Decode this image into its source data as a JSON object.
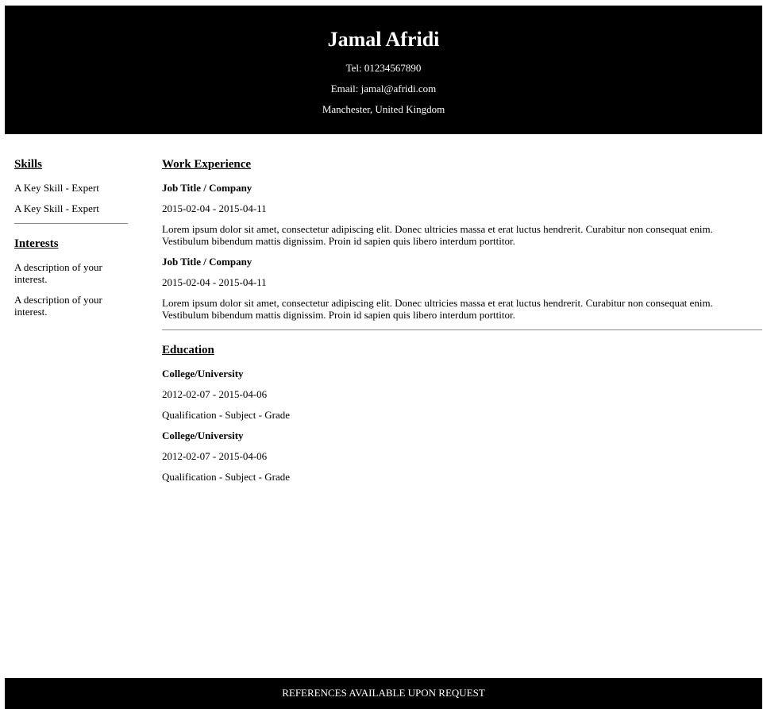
{
  "header": {
    "name": "Jamal Afridi",
    "tel": "Tel: 01234567890",
    "email": "Email: jamal@afridi.com",
    "location": "Manchester, United Kingdom"
  },
  "sidebar": {
    "skills_title": "Skills",
    "skills": [
      "A Key Skill - Expert",
      "A Key Skill - Expert"
    ],
    "interests_title": "Interests",
    "interests": [
      "A description of your interest.",
      "A description of your interest."
    ]
  },
  "work": {
    "title": "Work Experience",
    "entries": [
      {
        "role": "Job Title / Company",
        "dates": "2015-02-04 - 2015-04-11",
        "description": "Lorem ipsum dolor sit amet, consectetur adipiscing elit. Donec ultricies massa et erat luctus hendrerit. Curabitur non consequat enim. Vestibulum bibendum mattis dignissim. Proin id sapien quis libero interdum porttitor."
      },
      {
        "role": "Job Title / Company",
        "dates": "2015-02-04 - 2015-04-11",
        "description": "Lorem ipsum dolor sit amet, consectetur adipiscing elit. Donec ultricies massa et erat luctus hendrerit. Curabitur non consequat enim. Vestibulum bibendum mattis dignissim. Proin id sapien quis libero interdum porttitor."
      }
    ]
  },
  "education": {
    "title": "Education",
    "entries": [
      {
        "institution": "College/University",
        "dates": "2012-02-07 - 2015-04-06",
        "qualification": "Qualification - Subject - Grade"
      },
      {
        "institution": "College/University",
        "dates": "2012-02-07 - 2015-04-06",
        "qualification": "Qualification - Subject - Grade"
      }
    ]
  },
  "footer": {
    "text": "REFERENCES AVAILABLE UPON REQUEST"
  }
}
